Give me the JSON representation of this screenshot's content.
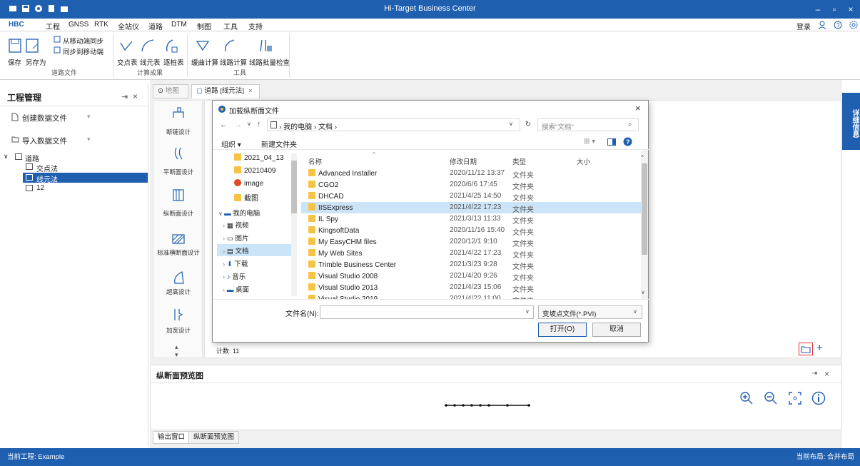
{
  "window": {
    "title": "Hi-Target Business Center"
  },
  "menu": {
    "hbc": "HBC",
    "items": [
      "工程",
      "GNSS",
      "RTK",
      "全站仪",
      "道路",
      "DTM",
      "制图",
      "工具",
      "支持"
    ],
    "login": "登录"
  },
  "ribbon": {
    "save": "保存",
    "save_as": "另存为",
    "sync_from_mobile": "从移动端同步",
    "sync_to_mobile": "同步到移动端",
    "group_road_file": "道路文件",
    "intersection_table": "交点表",
    "line_element_table": "线元表",
    "station_table": "逐桩表",
    "group_results": "计算成果",
    "curve_calc": "缓曲计算",
    "route_calc": "线路计算",
    "batch_check": "线路批量检查",
    "group_tools": "工具"
  },
  "left_panel": {
    "title": "工程管理",
    "create_data_file": "创建数据文件",
    "import_data_file": "导入数据文件",
    "tree": {
      "root": "道路",
      "children": [
        "交点法",
        "线元法",
        "12"
      ]
    }
  },
  "tabs": {
    "map": "地图",
    "road": "道路 [线元法]"
  },
  "tools": [
    "断链设计",
    "平断面设计",
    "纵断面设计",
    "标准横断面设计",
    "超高设计",
    "加宽设计"
  ],
  "count_label": "计数: 11",
  "right_strip": "详细信息",
  "dialog": {
    "title": "加载纵断面文件",
    "breadcrumb": [
      "我的电脑",
      "文档"
    ],
    "search_placeholder": "搜索\"文档\"",
    "organize": "组织 ▾",
    "new_folder": "新建文件夹",
    "nav": [
      "2021_04_13",
      "20210409",
      "image",
      "截图",
      "我的电脑",
      "视频",
      "图片",
      "文档",
      "下载",
      "音乐",
      "桌面"
    ],
    "columns": [
      "名称",
      "修改日期",
      "类型",
      "大小"
    ],
    "files": [
      {
        "name": "Advanced Installer",
        "date": "2020/11/12 13:37",
        "type": "文件夹"
      },
      {
        "name": "CGO2",
        "date": "2020/6/6 17:45",
        "type": "文件夹"
      },
      {
        "name": "DHCAD",
        "date": "2021/4/25 14:50",
        "type": "文件夹"
      },
      {
        "name": "IISExpress",
        "date": "2021/4/22 17:23",
        "type": "文件夹"
      },
      {
        "name": "IL Spy",
        "date": "2021/3/13 11:33",
        "type": "文件夹"
      },
      {
        "name": "KingsoftData",
        "date": "2020/11/16 15:40",
        "type": "文件夹"
      },
      {
        "name": "My EasyCHM files",
        "date": "2020/12/1 9:10",
        "type": "文件夹"
      },
      {
        "name": "My Web Sites",
        "date": "2021/4/22 17:23",
        "type": "文件夹"
      },
      {
        "name": "Trimble Business Center",
        "date": "2021/3/23 9:28",
        "type": "文件夹"
      },
      {
        "name": "Visual Studio 2008",
        "date": "2021/4/20 9:26",
        "type": "文件夹"
      },
      {
        "name": "Visual Studio 2013",
        "date": "2021/4/23 15:06",
        "type": "文件夹"
      },
      {
        "name": "Visual Studio 2019",
        "date": "2021/4/22 11:00",
        "type": "文件夹"
      }
    ],
    "filename_label": "文件名(N):",
    "filename_value": "",
    "filetype": "变坡点文件(*.PVI)",
    "open": "打开(O)",
    "cancel": "取消"
  },
  "preview": {
    "title": "纵断面预览图"
  },
  "bottom_tabs": [
    "输出窗口",
    "纵断面预览图"
  ],
  "status": {
    "project": "当前工程: Example",
    "layout": "当前布局: 合并布局"
  },
  "colors": {
    "accent": "#1f5fb0",
    "folder": "#f6c445",
    "selected_row": "#cce4f7"
  }
}
